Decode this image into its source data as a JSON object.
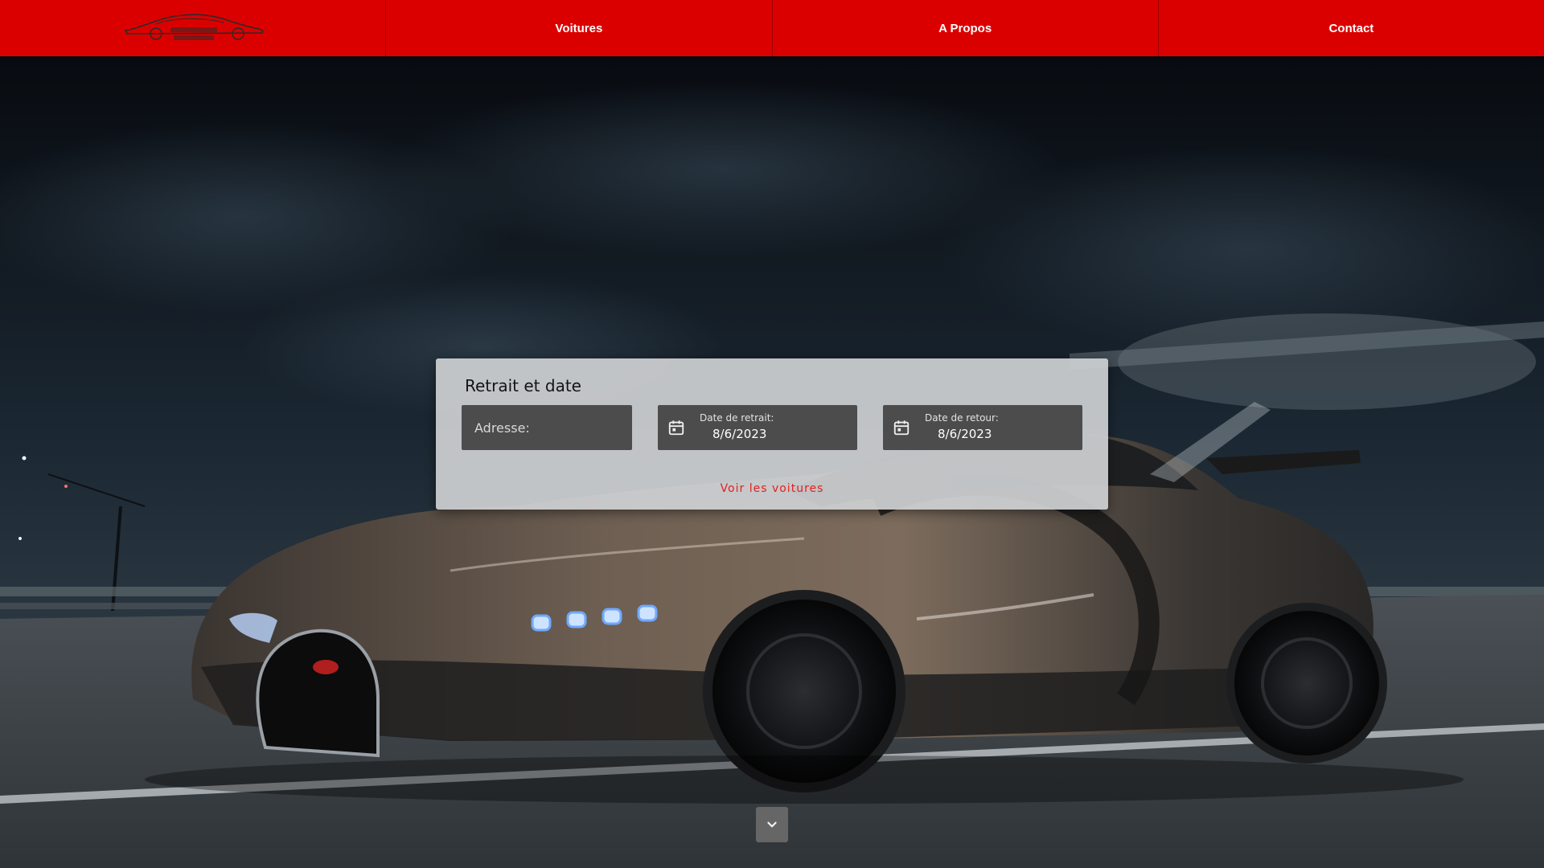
{
  "navbar": {
    "logo_icon": "car-logo-icon",
    "items": [
      {
        "label": "Voitures"
      },
      {
        "label": "A Propos"
      },
      {
        "label": "Contact"
      }
    ],
    "color": "#db0000"
  },
  "search_panel": {
    "title": "Retrait et date",
    "address": {
      "placeholder": "Adresse:",
      "value": ""
    },
    "pickup_date": {
      "label": "Date de retrait:",
      "value": "8/6/2023",
      "icon": "calendar-icon"
    },
    "return_date": {
      "label": "Date de retour:",
      "value": "8/6/2023",
      "icon": "calendar-icon"
    },
    "submit_label": "Voir les voitures",
    "accent_color": "#e22020"
  },
  "scroll_button": {
    "icon": "chevron-down-icon"
  }
}
